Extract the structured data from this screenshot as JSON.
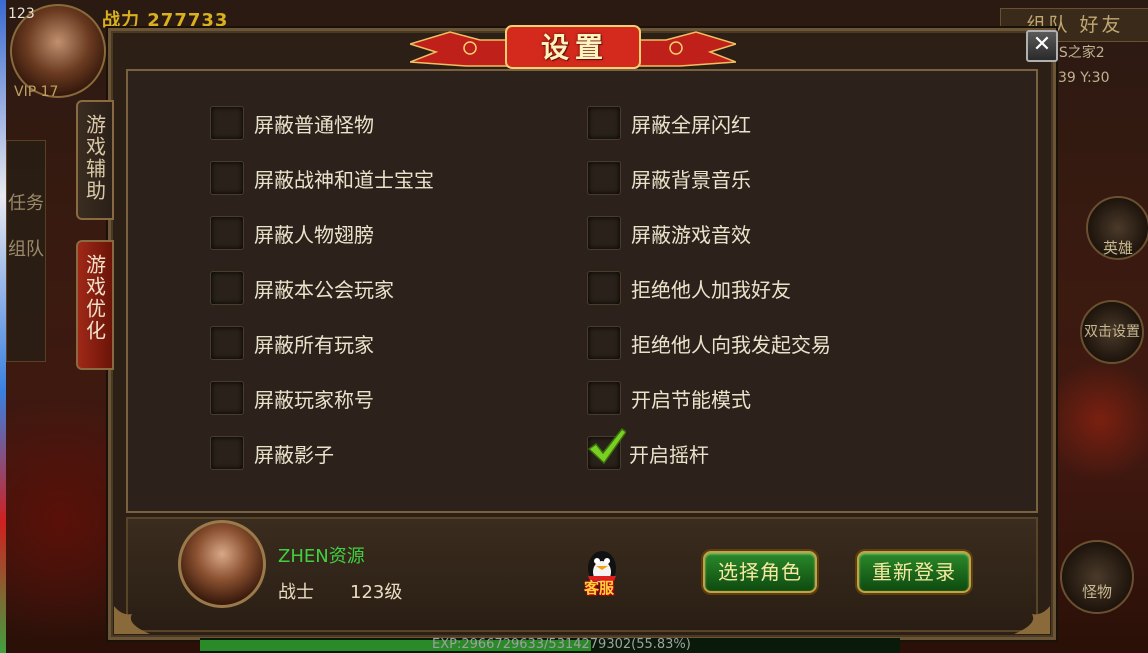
{
  "hud": {
    "level": "123",
    "name": "战力 277733",
    "vip": "VIP 17",
    "top_right": "组队 好友",
    "guild": "SS之家2",
    "coord": "39 Y:30",
    "side_tabs": [
      "任务",
      "组队"
    ],
    "right_buttons": [
      "英雄",
      "双击设置",
      "怪物"
    ]
  },
  "dialog": {
    "title": "设置",
    "close_label": "✕",
    "tabs": [
      {
        "label": "游戏辅助",
        "active": false
      },
      {
        "label": "游戏优化",
        "active": true
      }
    ],
    "options_left": [
      {
        "label": "屏蔽普通怪物",
        "checked": false
      },
      {
        "label": "屏蔽战神和道士宝宝",
        "checked": false
      },
      {
        "label": "屏蔽人物翅膀",
        "checked": false
      },
      {
        "label": "屏蔽本公会玩家",
        "checked": false
      },
      {
        "label": "屏蔽所有玩家",
        "checked": false
      },
      {
        "label": "屏蔽玩家称号",
        "checked": false
      },
      {
        "label": "屏蔽影子",
        "checked": false
      }
    ],
    "options_right": [
      {
        "label": "屏蔽全屏闪红",
        "checked": false
      },
      {
        "label": "屏蔽背景音乐",
        "checked": false
      },
      {
        "label": "屏蔽游戏音效",
        "checked": false
      },
      {
        "label": "拒绝他人加我好友",
        "checked": false
      },
      {
        "label": "拒绝他人向我发起交易",
        "checked": false
      },
      {
        "label": "开启节能模式",
        "checked": false
      },
      {
        "label": "开启摇杆",
        "checked": true
      }
    ]
  },
  "player": {
    "name": "ZHEN资源",
    "class": "战士",
    "level": "123级"
  },
  "buttons": {
    "customer_service": "客服",
    "select_role": "选择角色",
    "relogin": "重新登录"
  },
  "exp": {
    "text": "EXP:2966729633/5314279302(55.83%)",
    "fraction": 0.5583
  },
  "colors": {
    "player_name": "#40d040",
    "button_green": "#1e6a1e",
    "check_green": "#7ad020"
  }
}
